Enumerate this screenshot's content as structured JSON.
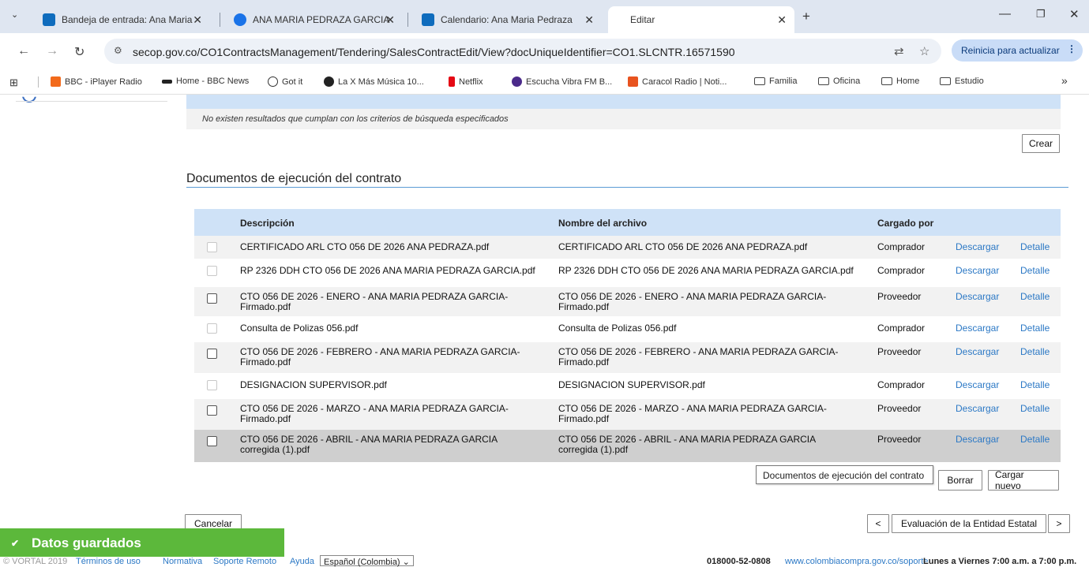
{
  "browser": {
    "tabs": [
      {
        "title": "Bandeja de entrada: Ana Maria",
        "color": "#0f6cbd"
      },
      {
        "title": "ANA MARIA PEDRAZA GARCIA",
        "color": "#1a73e8"
      },
      {
        "title": "Calendario: Ana Maria Pedraza",
        "color": "#0f6cbd"
      },
      {
        "title": "Editar",
        "color": "#ffffff"
      }
    ],
    "url": "secop.gov.co/CO1ContractsManagement/Tendering/SalesContractEdit/View?docUniqueIdentifier=CO1.SLCNTR.16571590",
    "update_button": "Reinicia para actualizar",
    "bookmarks": [
      {
        "label": "BBC - iPlayer Radio",
        "icon": "bbc-icon"
      },
      {
        "label": "Home - BBC News",
        "icon": "bbc-news-icon"
      },
      {
        "label": "Got it",
        "icon": "globe-icon"
      },
      {
        "label": "La X Más Música 10...",
        "icon": "radio-icon"
      },
      {
        "label": "Netflix",
        "icon": "netflix-icon"
      },
      {
        "label": "Escucha Vibra FM B...",
        "icon": "vibra-icon"
      },
      {
        "label": "Caracol Radio | Noti...",
        "icon": "caracol-icon"
      },
      {
        "label": "Familia",
        "icon": "folder-icon"
      },
      {
        "label": "Oficina",
        "icon": "folder-icon"
      },
      {
        "label": "Home",
        "icon": "folder-icon"
      },
      {
        "label": "Estudio",
        "icon": "folder-icon"
      }
    ]
  },
  "search_results": {
    "no_results": "No existen resultados que cumplan con los criterios de búsqueda especificados",
    "create_button": "Crear"
  },
  "documents": {
    "title": "Documentos de ejecución del contrato",
    "headers": {
      "description": "Descripción",
      "filename": "Nombre del archivo",
      "uploaded_by": "Cargado por"
    },
    "rows": [
      {
        "description": "CERTIFICADO ARL CTO 056 DE 2026 ANA PEDRAZA.pdf",
        "filename": "CERTIFICADO ARL CTO 056 DE 2026 ANA PEDRAZA.pdf",
        "uploaded_by": "Comprador",
        "download": "Descargar",
        "detail": "Detalle",
        "enabled": false
      },
      {
        "description": "RP 2326 DDH CTO 056 DE 2026 ANA MARIA PEDRAZA GARCIA.pdf",
        "filename": "RP 2326 DDH CTO 056 DE 2026 ANA MARIA PEDRAZA GARCIA.pdf",
        "uploaded_by": "Comprador",
        "download": "Descargar",
        "detail": "Detalle",
        "enabled": false
      },
      {
        "description": "CTO 056 DE 2026 - ENERO - ANA MARIA PEDRAZA GARCIA-\nFirmado.pdf",
        "filename": "CTO 056 DE 2026 - ENERO - ANA MARIA PEDRAZA GARCIA-\nFirmado.pdf",
        "uploaded_by": "Proveedor",
        "download": "Descargar",
        "detail": "Detalle",
        "enabled": true
      },
      {
        "description": "Consulta de Polizas 056.pdf",
        "filename": "Consulta de Polizas 056.pdf",
        "uploaded_by": "Comprador",
        "download": "Descargar",
        "detail": "Detalle",
        "enabled": false
      },
      {
        "description": "CTO 056 DE 2026 - FEBRERO - ANA MARIA PEDRAZA GARCIA-\nFirmado.pdf",
        "filename": "CTO 056 DE 2026 - FEBRERO - ANA MARIA PEDRAZA GARCIA-\nFirmado.pdf",
        "uploaded_by": "Proveedor",
        "download": "Descargar",
        "detail": "Detalle",
        "enabled": true
      },
      {
        "description": "DESIGNACION SUPERVISOR.pdf",
        "filename": "DESIGNACION SUPERVISOR.pdf",
        "uploaded_by": "Comprador",
        "download": "Descargar",
        "detail": "Detalle",
        "enabled": false
      },
      {
        "description": "CTO 056 DE 2026 - MARZO - ANA MARIA PEDRAZA GARCIA-\nFirmado.pdf",
        "filename": "CTO 056 DE 2026 - MARZO - ANA MARIA PEDRAZA GARCIA-\nFirmado.pdf",
        "uploaded_by": "Proveedor",
        "download": "Descargar",
        "detail": "Detalle",
        "enabled": true
      },
      {
        "description": "CTO 056 DE 2026 - ABRIL - ANA MARIA PEDRAZA GARCIA\ncorregida (1).pdf",
        "filename": "CTO 056 DE 2026 - ABRIL - ANA MARIA PEDRAZA GARCIA\ncorregida (1).pdf",
        "uploaded_by": "Proveedor",
        "download": "Descargar",
        "detail": "Detalle",
        "enabled": true
      }
    ],
    "tooltip": "Documentos de ejecución del contrato",
    "delete_button": "Borrar",
    "upload_button": "Cargar nuevo"
  },
  "actions": {
    "cancel_button": "Cancelar",
    "prev_button": "<",
    "next_step_button": "Evaluación de la Entidad Estatal",
    "next_button": ">"
  },
  "toast": {
    "message": "Datos guardados"
  },
  "footer": {
    "copyright": "© VORTAL 2019",
    "terms": "Términos de uso",
    "rules": "Normativa",
    "remote_support": "Soporte Remoto",
    "help": "Ayuda",
    "language": "Español (Colombia)",
    "phone": "018000-52-0808",
    "support_url": "www.colombiacompra.gov.co/soporte",
    "hours": "Lunes a Viernes 7:00 a.m. a 7:00 p.m."
  }
}
